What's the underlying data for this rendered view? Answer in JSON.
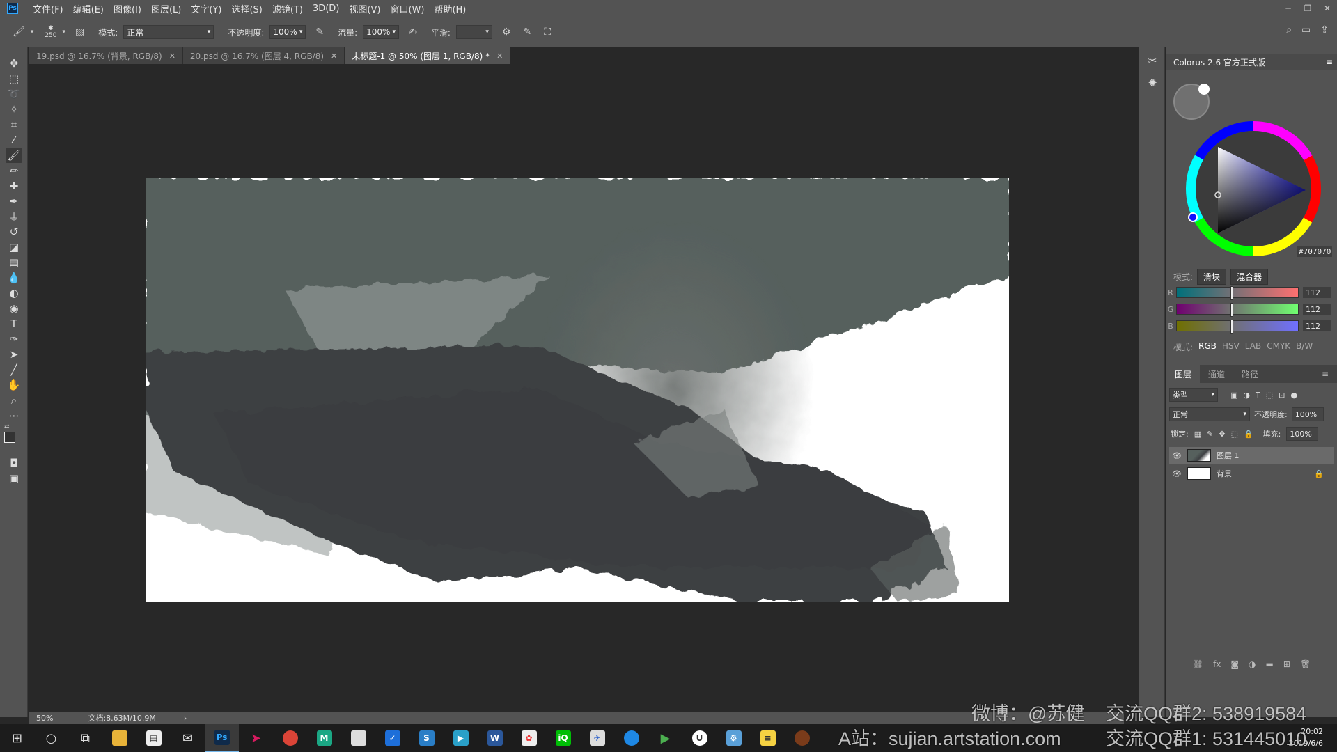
{
  "menubar": {
    "logo": "Ps",
    "items": [
      "文件(F)",
      "编辑(E)",
      "图像(I)",
      "图层(L)",
      "文字(Y)",
      "选择(S)",
      "滤镜(T)",
      "3D(D)",
      "视图(V)",
      "窗口(W)",
      "帮助(H)"
    ]
  },
  "options": {
    "brush_size": "250",
    "mode_label": "模式:",
    "mode_value": "正常",
    "opacity_label": "不透明度:",
    "opacity_value": "100%",
    "flow_label": "流量:",
    "flow_value": "100%",
    "smooth_label": "平滑:",
    "smooth_value": ""
  },
  "tabs": [
    {
      "label": "19.psd @ 16.7% (背景, RGB/8)"
    },
    {
      "label": "20.psd @ 16.7% (图层 4, RGB/8)"
    },
    {
      "label": "未标题-1 @ 50% (图层 1, RGB/8) *"
    }
  ],
  "status": {
    "zoom": "50%",
    "doc": "文档:8.63M/10.9M"
  },
  "colorpanel": {
    "title": "Colorus 2.6 官方正式版",
    "hex": "#707070",
    "mode_label": "模式:",
    "btn_slider": "滑块",
    "btn_mixer": "混合器",
    "channels": [
      {
        "name": "R",
        "value": "112",
        "fraction": 0.44
      },
      {
        "name": "G",
        "value": "112",
        "fraction": 0.44
      },
      {
        "name": "B",
        "value": "112",
        "fraction": 0.44
      }
    ],
    "color_modes_label": "模式:",
    "color_modes": [
      "RGB",
      "HSV",
      "LAB",
      "CMYK",
      "B/W"
    ],
    "current_color": "#707070"
  },
  "layers": {
    "tabs": [
      "图层",
      "通道",
      "路径"
    ],
    "filter": "类型",
    "blend": "正常",
    "opacity_label": "不透明度:",
    "opacity": "100%",
    "lock_label": "锁定:",
    "fill_label": "填充:",
    "fill": "100%",
    "items": [
      {
        "name": "图层 1",
        "selected": true
      },
      {
        "name": "背景",
        "selected": false
      }
    ]
  },
  "taskbar": {
    "time": "20:02",
    "date": "2019/6/6"
  },
  "watermark": {
    "line1_left": "微博：@苏健",
    "line1_right": "交流QQ群2: 538919584",
    "line2_left": "A站：sujian.artstation.com",
    "line2_right": "交流QQ群1: 531445010"
  }
}
